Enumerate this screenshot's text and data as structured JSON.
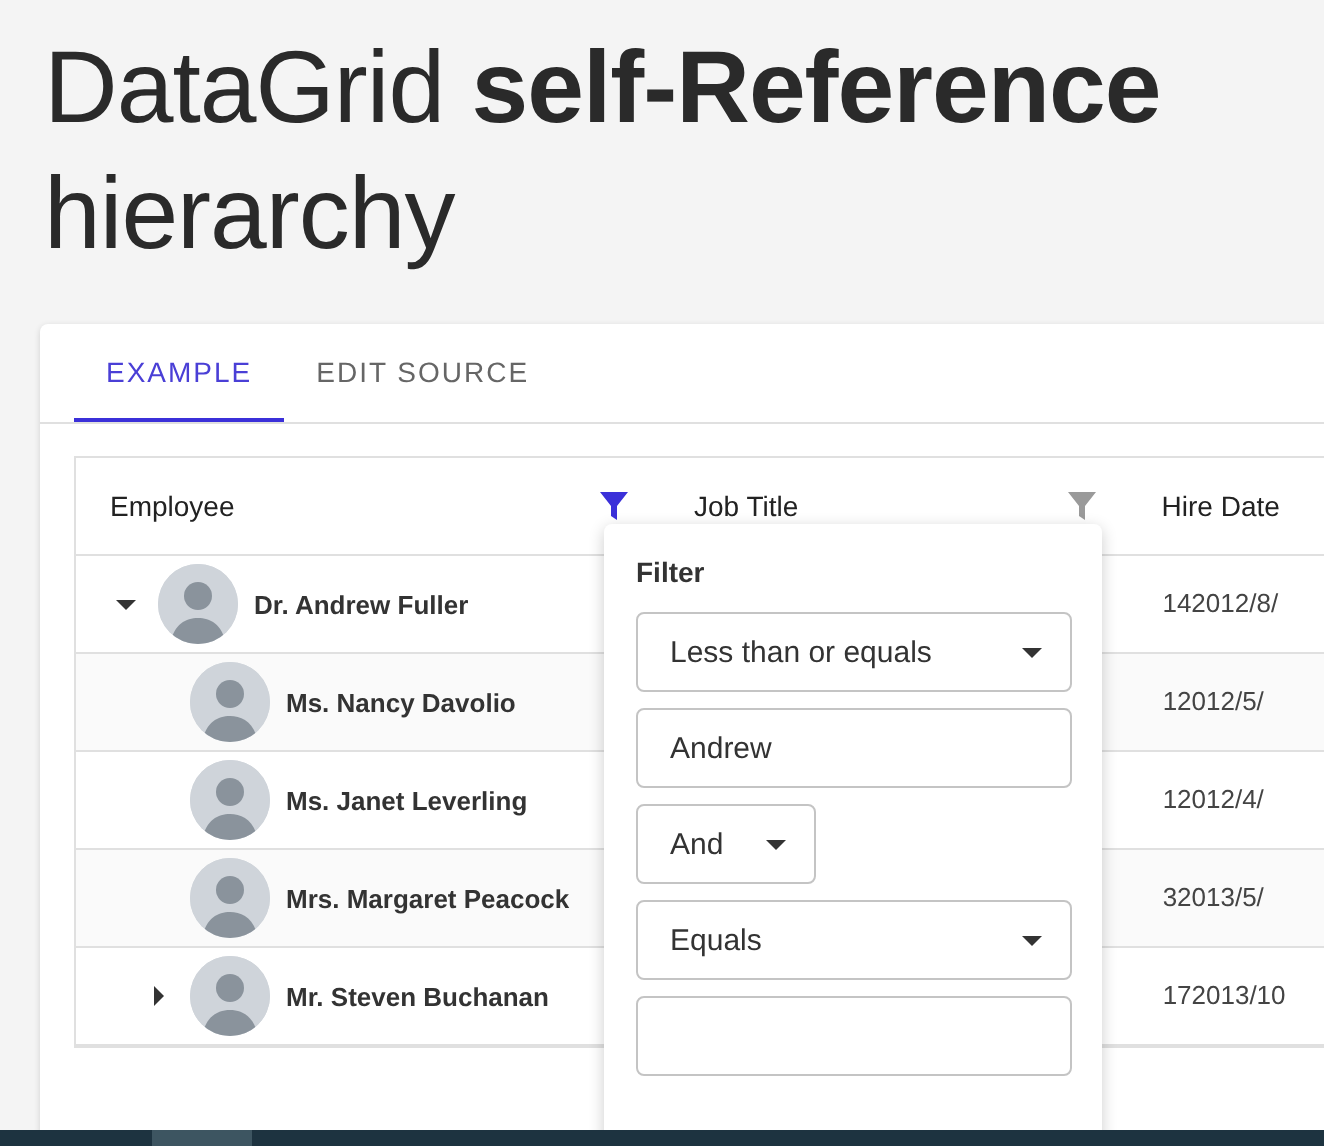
{
  "title": "DataGrid **self-Reference** hierarchy",
  "tabs": [
    {
      "label": "EXAMPLE",
      "selected": true
    },
    {
      "label": "EDIT SOURCE",
      "selected": false
    }
  ],
  "grid": {
    "columns": [
      {
        "label": "Employee",
        "filtered": true
      },
      {
        "label": "Job Title",
        "filtered": false
      },
      {
        "label": "Hire Date"
      }
    ],
    "rows": [
      {
        "name": "Dr. Andrew Fuller",
        "hire_date": "142012/8/",
        "expanded": true,
        "children": [
          {
            "name": "Ms. Nancy Davolio",
            "hire_date": "12012/5/"
          },
          {
            "name": "Ms. Janet Leverling",
            "hire_date": "12012/4/"
          },
          {
            "name": "Mrs. Margaret Peacock",
            "hire_date": "32013/5/"
          },
          {
            "name": "Mr. Steven Buchanan",
            "hire_date": "172013/10",
            "expanded": false
          }
        ]
      }
    ]
  },
  "filter": {
    "title": "Filter",
    "fields": [
      {
        "kind": "select",
        "value": "Less than or equals",
        "wide": true
      },
      {
        "kind": "input",
        "value": "Andrew"
      },
      {
        "kind": "select",
        "value": "And",
        "wide": false
      },
      {
        "kind": "select",
        "value": "Equals",
        "wide": true
      },
      {
        "kind": "input"
      }
    ]
  }
}
